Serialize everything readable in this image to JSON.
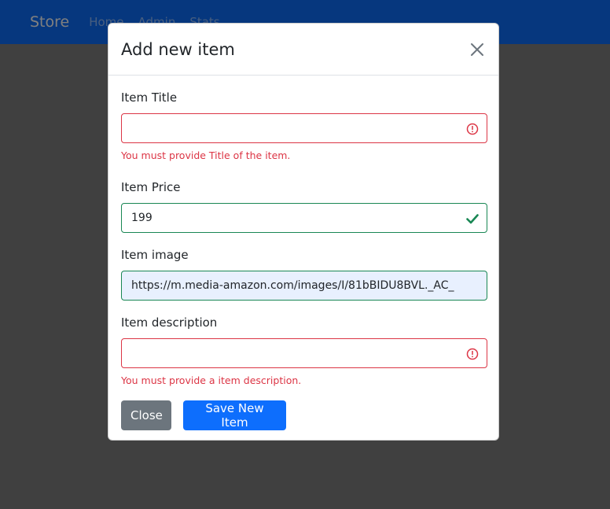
{
  "navbar": {
    "brand": "Store",
    "links": [
      "Home",
      "Admin",
      "Stats"
    ]
  },
  "modal": {
    "title": "Add new item",
    "fields": {
      "title": {
        "label": "Item Title",
        "value": "",
        "error": "You must provide Title of the item.",
        "status": "invalid"
      },
      "price": {
        "label": "Item Price",
        "value": "199",
        "status": "valid"
      },
      "image": {
        "label": "Item image",
        "value": "https://m.media-amazon.com/images/I/81bBIDU8BVL._AC_",
        "status": "autofilled"
      },
      "description": {
        "label": "Item description",
        "value": "",
        "error": "You must provide a item description.",
        "status": "invalid"
      }
    },
    "buttons": {
      "close": "Close",
      "save": "Save New Item"
    }
  },
  "colors": {
    "primary": "#0d6efd",
    "danger": "#dc3545",
    "success": "#198754",
    "secondary": "#6c757d"
  },
  "icons": {
    "close": "close-icon",
    "error": "exclamation-circle-icon",
    "valid": "check-icon"
  }
}
